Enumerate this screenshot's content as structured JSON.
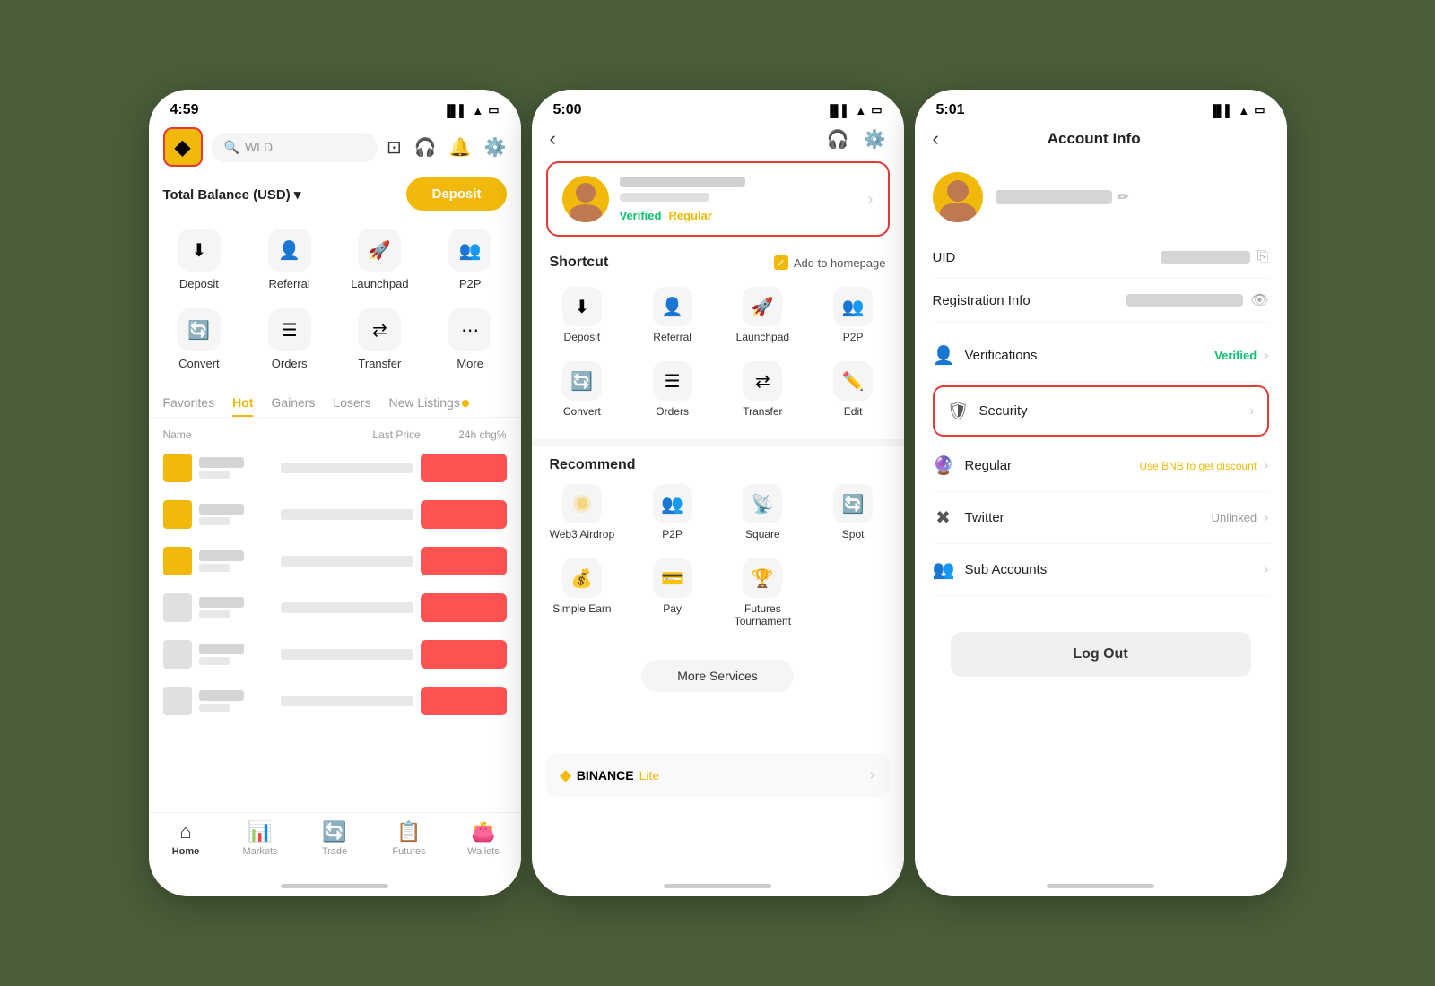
{
  "screen1": {
    "time": "4:59",
    "search_placeholder": "WLD",
    "balance_label": "Total Balance (USD) ▾",
    "deposit_btn": "Deposit",
    "actions": [
      {
        "icon": "⬇️",
        "label": "Deposit"
      },
      {
        "icon": "👤+",
        "label": "Referral"
      },
      {
        "icon": "🚀",
        "label": "Launchpad"
      },
      {
        "icon": "👥",
        "label": "P2P"
      },
      {
        "icon": "🔄",
        "label": "Convert"
      },
      {
        "icon": "≡",
        "label": "Orders"
      },
      {
        "icon": "⇌",
        "label": "Transfer"
      },
      {
        "icon": "⋯",
        "label": "More"
      }
    ],
    "tabs": [
      "Favorites",
      "Hot",
      "Gainers",
      "Losers",
      "New Listings"
    ],
    "active_tab": "Hot",
    "table_headers": [
      "Name",
      "Last Price",
      "24h chg%"
    ],
    "rows": [
      {
        "change": "-"
      },
      {
        "change": "-"
      },
      {
        "change": "-"
      },
      {
        "change": "-"
      },
      {
        "change": "-"
      },
      {
        "change": "-"
      }
    ],
    "nav_items": [
      {
        "icon": "🏠",
        "label": "Home",
        "active": true
      },
      {
        "icon": "📊",
        "label": "Markets"
      },
      {
        "icon": "🔄",
        "label": "Trade"
      },
      {
        "icon": "📈",
        "label": "Futures"
      },
      {
        "icon": "👛",
        "label": "Wallets"
      }
    ]
  },
  "screen2": {
    "time": "5:00",
    "verified_label": "Verified",
    "regular_label": "Regular",
    "shortcut_title": "Shortcut",
    "add_homepage": "Add to homepage",
    "shortcut_services": [
      {
        "icon": "⬇️",
        "label": "Deposit"
      },
      {
        "icon": "👤+",
        "label": "Referral"
      },
      {
        "icon": "🚀",
        "label": "Launchpad"
      },
      {
        "icon": "👥",
        "label": "P2P"
      },
      {
        "icon": "🔄",
        "label": "Convert"
      },
      {
        "icon": "≡",
        "label": "Orders"
      },
      {
        "icon": "⇌",
        "label": "Transfer"
      },
      {
        "icon": "✏️",
        "label": "Edit"
      }
    ],
    "recommend_title": "Recommend",
    "recommend_services": [
      {
        "icon": "🌐",
        "label": "Web3 Airdrop"
      },
      {
        "icon": "👥",
        "label": "P2P"
      },
      {
        "icon": "📡",
        "label": "Square"
      },
      {
        "icon": "📈",
        "label": "Spot"
      },
      {
        "icon": "💰",
        "label": "Simple Earn"
      },
      {
        "icon": "💳",
        "label": "Pay"
      },
      {
        "icon": "🏆",
        "label": "Futures Tournament"
      }
    ],
    "more_services_btn": "More Services",
    "binance_lite": "BINANCE",
    "lite_text": "Lite"
  },
  "screen3": {
    "time": "5:01",
    "page_title": "Account Info",
    "uid_label": "UID",
    "reg_info_label": "Registration Info",
    "verifications_label": "Verifications",
    "verified_status": "Verified",
    "security_label": "Security",
    "regular_label": "Regular",
    "regular_desc": "Use BNB to get discount",
    "twitter_label": "Twitter",
    "twitter_status": "Unlinked",
    "sub_accounts_label": "Sub Accounts",
    "logout_btn": "Log Out"
  }
}
